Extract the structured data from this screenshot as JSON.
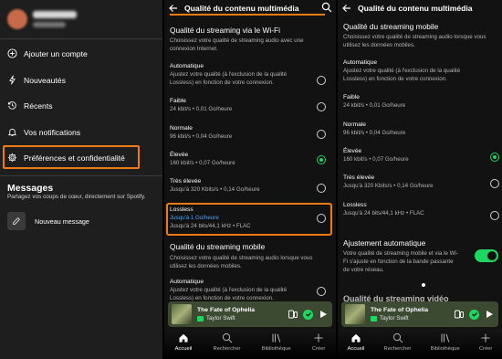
{
  "left_panel": {
    "menu": [
      {
        "label": "Ajouter un compte"
      },
      {
        "label": "Nouveautés"
      },
      {
        "label": "Récents"
      },
      {
        "label": "Vos notifications"
      },
      {
        "label": "Préférences et confidentialité"
      }
    ],
    "messages_title": "Messages",
    "messages_sub": "Partagez vos coups de cœur, directement sur Spotify.",
    "new_message": "Nouveau message"
  },
  "middle_panel": {
    "title": "Qualité du contenu multimédia",
    "wifi_title": "Qualité du streaming via le Wi-Fi",
    "wifi_desc": "Choisissez votre qualité de streaming audio avec une connexion Internet.",
    "options": [
      {
        "title": "Automatique",
        "desc": "Ajustez votre qualité (à l'exclusion de la qualité Lossless) en fonction de votre connexion.",
        "selected": false
      },
      {
        "title": "Faible",
        "desc": "24 kbit/s • 0,01 Go/heure",
        "selected": false
      },
      {
        "title": "Normale",
        "desc": "96 kbit/s • 0,04 Go/heure",
        "selected": false
      },
      {
        "title": "Élevée",
        "desc": "160 kbit/s • 0,07 Go/heure",
        "selected": true
      },
      {
        "title": "Très élevée",
        "desc": "Jusqu'à 320 Kbits/s • 0,14 Go/heure",
        "selected": false
      },
      {
        "title": "Lossless",
        "desc_blue": "Jusqu'à 1 Go/heure",
        "desc": "Jusqu'à 24 bits/44,1 kHz • FLAC",
        "selected": false
      }
    ],
    "mobile_title": "Qualité du streaming mobile",
    "mobile_desc": "Choisissez votre qualité de streaming audio lorsque vous utilisez les données mobiles.",
    "mobile_auto_title": "Automatique",
    "mobile_auto_desc": "Ajustez votre qualité (à l'exclusion de la qualité Lossless) en fonction de votre connexion."
  },
  "right_panel": {
    "title": "Qualité du contenu multimédia",
    "mobile_title": "Qualité du streaming mobile",
    "mobile_desc": "Choisissez votre qualité de streaming audio lorsque vous utilisez les données mobiles.",
    "options": [
      {
        "title": "Automatique",
        "desc": "Ajustez votre qualité (à l'exclusion de la qualité Lossless) en fonction de votre connexion.",
        "selected": false
      },
      {
        "title": "Faible",
        "desc": "24 kbit/s • 0,01 Go/heure",
        "selected": false
      },
      {
        "title": "Normale",
        "desc": "96 kbit/s • 0,04 Go/heure",
        "selected": false
      },
      {
        "title": "Élevée",
        "desc": "160 kbit/s • 0,07 Go/heure",
        "selected": true
      },
      {
        "title": "Très élevée",
        "desc": "Jusqu'à 320 Kbits/s • 0,14 Go/heure",
        "selected": false
      },
      {
        "title": "Lossless",
        "desc": "Jusqu'à 24 bits/44,1 kHz • FLAC",
        "selected": false
      }
    ],
    "auto_adjust_title": "Ajustement automatique",
    "auto_adjust_desc": "Votre qualité de streaming mobile et via le Wi-Fi s'ajuste en fonction de la bande passante de votre réseau.",
    "auto_adjust_on": true,
    "partial_title": "Qualité du streaming vidéo"
  },
  "player": {
    "title": "The Fate of Ophelia",
    "artist": "Taylor Swift"
  },
  "nav": [
    "Accueil",
    "Rechercher",
    "Bibliothèque",
    "Créer"
  ],
  "colors": {
    "accent": "#1ed760",
    "highlight": "#f07a14",
    "link": "#4aa3ff"
  }
}
